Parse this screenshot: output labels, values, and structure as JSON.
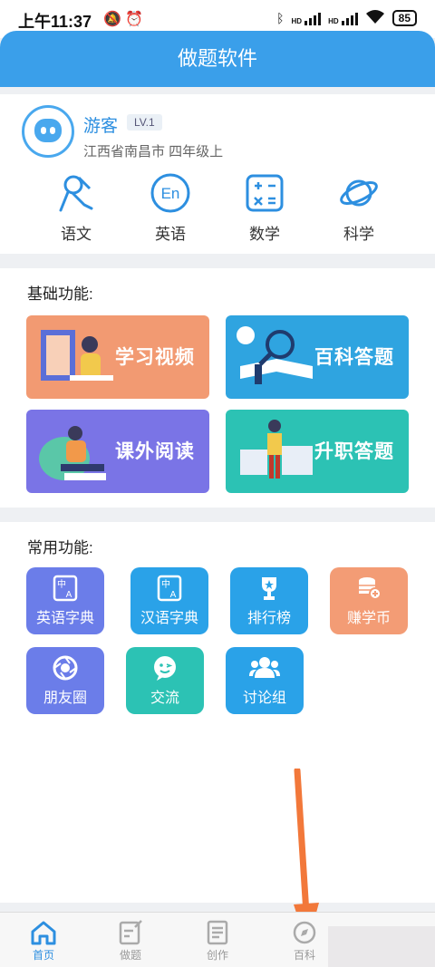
{
  "status_bar": {
    "time": "上午11:37",
    "left_icons": "🔕 ⏰",
    "battery": "85",
    "net_labels": [
      "HD",
      "HD"
    ]
  },
  "header": {
    "title": "做题软件"
  },
  "profile": {
    "name": "游客",
    "level": "LV.1",
    "location": "江西省南昌市  四年级上"
  },
  "subjects": [
    {
      "label": "语文",
      "icon": "chinese-brush-icon"
    },
    {
      "label": "英语",
      "icon": "english-en-icon",
      "glyph": "En"
    },
    {
      "label": "数学",
      "icon": "math-calculator-icon",
      "glyph": "+ -\n× ="
    },
    {
      "label": "科学",
      "icon": "planet-icon"
    }
  ],
  "basic_section": {
    "title": "基础功能:",
    "cards": [
      {
        "label": "学习视频",
        "color": "#f29a72"
      },
      {
        "label": "百科答题",
        "color": "#2fa4e0"
      },
      {
        "label": "课外阅读",
        "color": "#7a74e6"
      },
      {
        "label": "升职答题",
        "color": "#2cc2b4"
      }
    ]
  },
  "common_section": {
    "title": "常用功能:",
    "tiles": [
      {
        "label": "英语字典",
        "color": "#6b7de9",
        "icon": "dictionary-icon"
      },
      {
        "label": "汉语字典",
        "color": "#2aa2e8",
        "icon": "dictionary-icon"
      },
      {
        "label": "排行榜",
        "color": "#2aa2e8",
        "icon": "trophy-icon"
      },
      {
        "label": "赚学币",
        "color": "#f39c75",
        "icon": "coins-icon"
      },
      {
        "label": "朋友圈",
        "color": "#6b7de9",
        "icon": "aperture-icon"
      },
      {
        "label": "交流",
        "color": "#2cc2b4",
        "icon": "smiley-chat-icon"
      },
      {
        "label": "讨论组",
        "color": "#2aa2e8",
        "icon": "group-icon"
      }
    ],
    "dict_glyphs": {
      "top": "中",
      "bottom": "A"
    }
  },
  "tabbar": {
    "tabs": [
      {
        "label": "首页",
        "icon": "home-icon",
        "active": true
      },
      {
        "label": "做题",
        "icon": "edit-icon",
        "active": false
      },
      {
        "label": "创作",
        "icon": "document-icon",
        "active": false
      },
      {
        "label": "百科",
        "icon": "compass-icon",
        "active": false
      }
    ]
  },
  "colors": {
    "primary": "#3a9fea",
    "arrow": "#f2783a"
  }
}
